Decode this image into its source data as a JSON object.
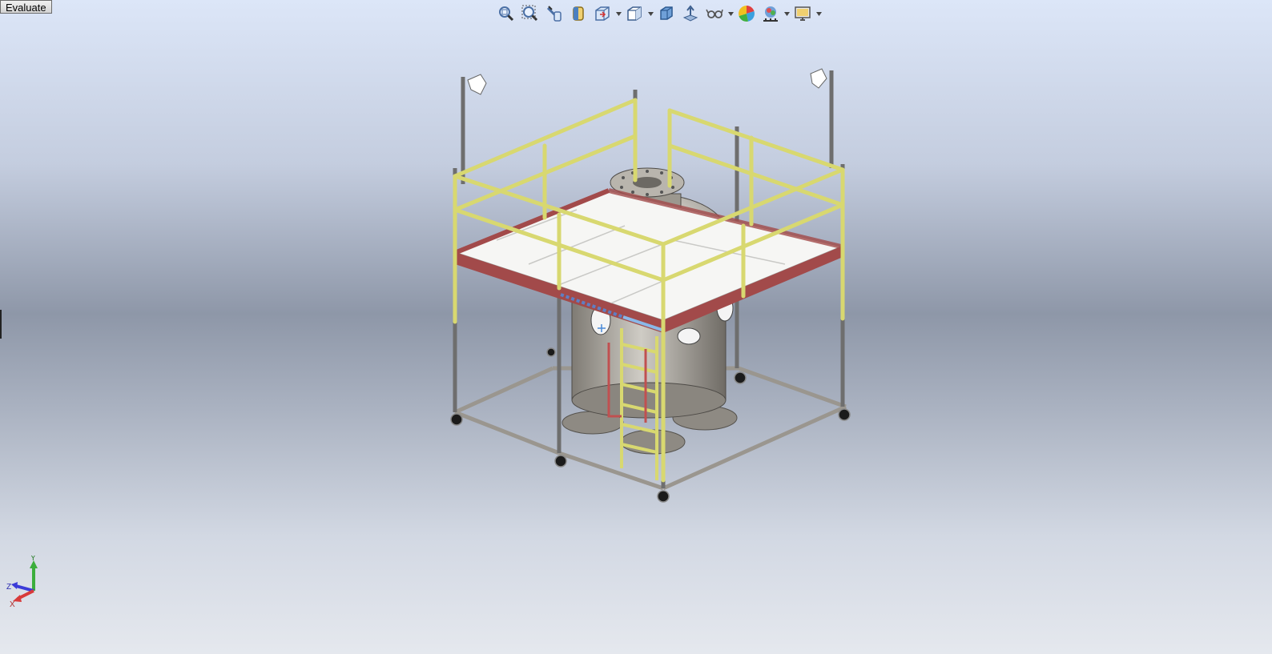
{
  "command_tab": {
    "label": "Evaluate"
  },
  "toolbar": {
    "buttons": [
      {
        "id": "zoom-to-fit",
        "icon": "zoom-to-fit-icon"
      },
      {
        "id": "zoom-to-area",
        "icon": "zoom-to-area-icon"
      },
      {
        "id": "previous-view",
        "icon": "previous-view-icon"
      },
      {
        "id": "section-view",
        "icon": "section-view-icon"
      },
      {
        "id": "view-orientation",
        "icon": "view-orientation-icon",
        "dropdown": true
      },
      {
        "id": "display-style",
        "icon": "display-style-icon",
        "dropdown": true
      },
      {
        "id": "hide-show-items",
        "icon": "hide-show-items-icon"
      },
      {
        "id": "edit-appearance",
        "icon": "edit-appearance-icon"
      },
      {
        "id": "apply-scene",
        "icon": "apply-scene-icon",
        "dropdown": true
      },
      {
        "id": "view-settings",
        "icon": "view-settings-icon"
      },
      {
        "id": "display-pane",
        "icon": "display-pane-icon",
        "dropdown": true
      },
      {
        "id": "monitor-settings",
        "icon": "monitor-icon",
        "dropdown": true
      }
    ]
  },
  "colors": {
    "railing": "#d8d870",
    "railing_dark": "#a9a948",
    "platform_edge": "#a24a4a",
    "platform_deck": "#f6f6f4",
    "frame": "#9a968f",
    "vessel": "#b2aea6",
    "post": "#6e6e6e"
  },
  "triad": {
    "x_label": "X",
    "y_label": "Y",
    "z_label": "Z"
  }
}
